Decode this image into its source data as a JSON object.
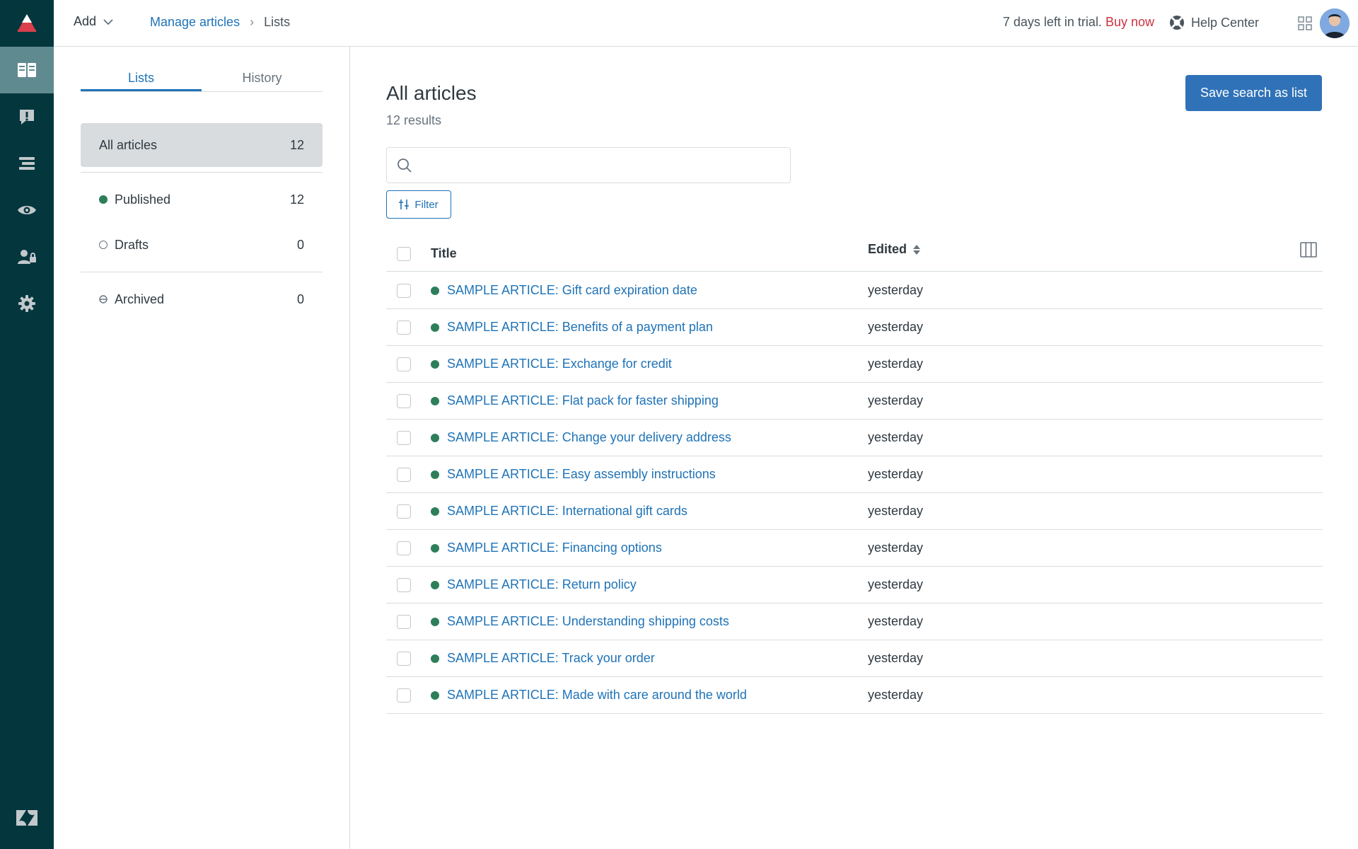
{
  "topbar": {
    "add_label": "Add",
    "breadcrumb": {
      "link": "Manage articles",
      "separator": "›",
      "current": "Lists"
    },
    "trial_text": "7 days left in trial.",
    "buy_now": "Buy now",
    "help_center": "Help Center"
  },
  "rail": {
    "items": [
      "knowledge-icon",
      "alert-icon",
      "arrange-icon",
      "eye-icon",
      "user-lock-icon",
      "gear-icon"
    ],
    "colors": {
      "background": "#03363d",
      "active": "#5f8a8f",
      "accent": "#d93f4c"
    }
  },
  "sidepanel": {
    "tabs": [
      {
        "label": "Lists",
        "active": true
      },
      {
        "label": "History",
        "active": false
      }
    ],
    "lists": [
      {
        "label": "All articles",
        "count": "12"
      },
      {
        "label": "Published",
        "count": "12"
      },
      {
        "label": "Drafts",
        "count": "0"
      },
      {
        "label": "Archived",
        "count": "0"
      }
    ]
  },
  "main": {
    "title": "All articles",
    "result_count": "12 results",
    "save_button": "Save search as list",
    "search_placeholder": "",
    "filter_label": "Filter",
    "columns": {
      "title": "Title",
      "edited": "Edited"
    },
    "articles": [
      {
        "title": "SAMPLE ARTICLE: Gift card expiration date",
        "edited": "yesterday"
      },
      {
        "title": "SAMPLE ARTICLE: Benefits of a payment plan",
        "edited": "yesterday"
      },
      {
        "title": "SAMPLE ARTICLE: Exchange for credit",
        "edited": "yesterday"
      },
      {
        "title": "SAMPLE ARTICLE: Flat pack for faster shipping",
        "edited": "yesterday"
      },
      {
        "title": "SAMPLE ARTICLE: Change your delivery address",
        "edited": "yesterday"
      },
      {
        "title": "SAMPLE ARTICLE: Easy assembly instructions",
        "edited": "yesterday"
      },
      {
        "title": "SAMPLE ARTICLE: International gift cards",
        "edited": "yesterday"
      },
      {
        "title": "SAMPLE ARTICLE: Financing options",
        "edited": "yesterday"
      },
      {
        "title": "SAMPLE ARTICLE: Return policy",
        "edited": "yesterday"
      },
      {
        "title": "SAMPLE ARTICLE: Understanding shipping costs",
        "edited": "yesterday"
      },
      {
        "title": "SAMPLE ARTICLE: Track your order",
        "edited": "yesterday"
      },
      {
        "title": "SAMPLE ARTICLE: Made with care around the world",
        "edited": "yesterday"
      }
    ]
  }
}
